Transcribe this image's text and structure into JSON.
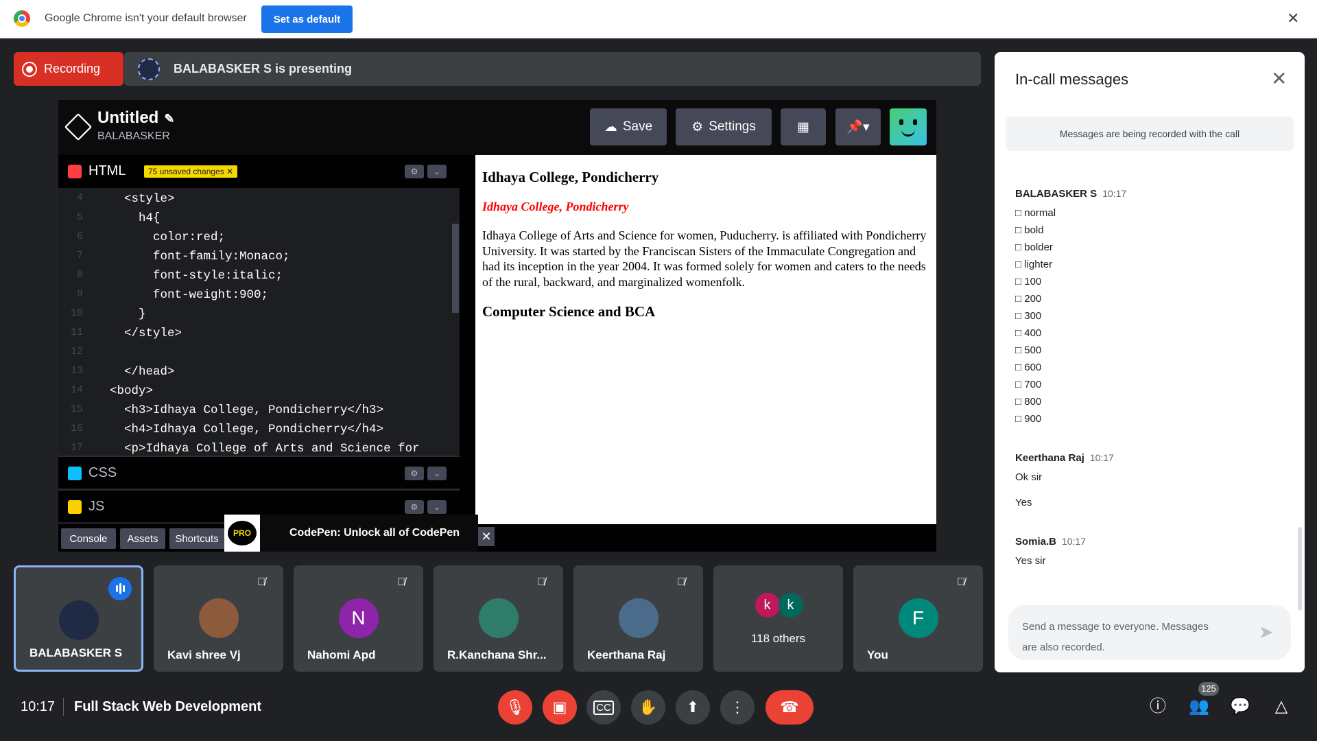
{
  "chrome": {
    "message": "Google Chrome isn't your default browser",
    "set_default": "Set as default",
    "close": "✕"
  },
  "meet": {
    "recording_label": "Recording",
    "presenting_text": "BALABASKER S is presenting",
    "time": "10:17",
    "title": "Full Stack Web Development",
    "participants_count": "125"
  },
  "codepen": {
    "title": "Untitled",
    "user": "BALABASKER",
    "save": "Save",
    "settings": "Settings",
    "html_label": "HTML",
    "css_label": "CSS",
    "js_label": "JS",
    "unsaved": "75 unsaved changes",
    "tabs": [
      "Console",
      "Assets",
      "Shortcuts"
    ],
    "promo_badge": "PRO",
    "promo_text": "CodePen: Unlock all of CodePen",
    "code_lines": [
      {
        "n": "4",
        "t": "  <style>"
      },
      {
        "n": "5",
        "t": "    h4{"
      },
      {
        "n": "6",
        "t": "      color:red;"
      },
      {
        "n": "7",
        "t": "      font-family:Monaco;"
      },
      {
        "n": "8",
        "t": "      font-style:italic;"
      },
      {
        "n": "9",
        "t": "      font-weight:900;"
      },
      {
        "n": "10",
        "t": "    }"
      },
      {
        "n": "11",
        "t": "  </style>"
      },
      {
        "n": "12",
        "t": ""
      },
      {
        "n": "13",
        "t": "  </head>"
      },
      {
        "n": "14",
        "t": "<body>"
      },
      {
        "n": "15",
        "t": "  <h3>Idhaya College, Pondicherry</h3>"
      },
      {
        "n": "16",
        "t": "  <h4>Idhaya College, Pondicherry</h4>"
      },
      {
        "n": "17",
        "t": "  <p>Idhaya College of Arts and Science for"
      }
    ],
    "preview": {
      "h3": "Idhaya College, Pondicherry",
      "h4": "Idhaya College, Pondicherry",
      "p": "Idhaya College of Arts and Science for women, Puducherry. is affiliated with Pondicherry University. It was started by the Franciscan Sisters of the Immaculate Congregation and had its inception in the year 2004. It was formed solely for women and caters to the needs of the rural, backward, and marginalized womenfolk.",
      "h3b": "Computer Science and BCA"
    }
  },
  "tiles": [
    {
      "name": "BALABASKER S",
      "initial": "",
      "color": "#1f2a44",
      "active": true
    },
    {
      "name": "Kavi shree Vj",
      "initial": "",
      "color": "#8d5a3b",
      "active": false
    },
    {
      "name": "Nahomi Apd",
      "initial": "N",
      "color": "#8e24aa",
      "active": false
    },
    {
      "name": "R.Kanchana Shr...",
      "initial": "",
      "color": "#2e7d6a",
      "active": false
    },
    {
      "name": "Keerthana Raj",
      "initial": "",
      "color": "#4a6b8a",
      "active": false
    },
    {
      "name": "118 others",
      "initial": "k",
      "initial2": "k",
      "color": "#c2185b",
      "color2": "#00695c",
      "active": false
    },
    {
      "name": "You",
      "initial": "F",
      "color": "#00897b",
      "active": false
    }
  ],
  "messages": {
    "title": "In-call messages",
    "notice": "Messages are being recorded with the call",
    "placeholder_line1": "Send a message to everyone. Messages",
    "placeholder_line2": "are also recorded.",
    "groups": [
      {
        "sender": "BALABASKER S",
        "time": "10:17",
        "lines": [
          "□ normal",
          "□ bold",
          "□ bolder",
          "□ lighter",
          "□ 100",
          "□ 200",
          "□ 300",
          "□ 400",
          "□ 500",
          "□ 600",
          "□ 700",
          "□ 800",
          "□ 900"
        ]
      },
      {
        "sender": "Keerthana Raj",
        "time": "10:17",
        "lines": [
          "Ok sir",
          "",
          "Yes"
        ]
      },
      {
        "sender": "Somia.B",
        "time": "10:17",
        "lines": [
          "Yes sir"
        ]
      }
    ]
  },
  "colors": {
    "accent": "#1a73e8",
    "danger": "#ea4335",
    "background": "#202124",
    "tile": "#3c4043"
  }
}
